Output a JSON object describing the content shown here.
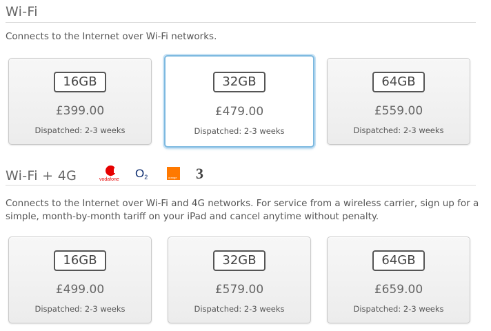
{
  "wifi": {
    "title": "Wi-Fi",
    "description": "Connects to the Internet over Wi-Fi networks.",
    "options": [
      {
        "capacity": "16GB",
        "price": "£399.00",
        "dispatch": "Dispatched: 2-3 weeks",
        "selected": false
      },
      {
        "capacity": "32GB",
        "price": "£479.00",
        "dispatch": "Dispatched: 2-3 weeks",
        "selected": true
      },
      {
        "capacity": "64GB",
        "price": "£559.00",
        "dispatch": "Dispatched: 2-3 weeks",
        "selected": false
      }
    ]
  },
  "wifi_4g": {
    "title": "Wi-Fi + 4G",
    "carriers": [
      {
        "name": "vodafone",
        "icon": "vodafone-logo",
        "label": "vodafone"
      },
      {
        "name": "O2",
        "icon": "o2-logo",
        "label": "O",
        "sub": "2"
      },
      {
        "name": "orange",
        "icon": "orange-logo",
        "label": "orange",
        "color": "#ff7900"
      },
      {
        "name": "3",
        "icon": "three-logo",
        "label": "3"
      }
    ],
    "description": "Connects to the Internet over Wi-Fi and 4G networks. For service from a wireless carrier, sign up for a simple, month-by-month tariff on your iPad and cancel anytime without penalty.",
    "options": [
      {
        "capacity": "16GB",
        "price": "£499.00",
        "dispatch": "Dispatched: 2-3 weeks",
        "selected": false
      },
      {
        "capacity": "32GB",
        "price": "£579.00",
        "dispatch": "Dispatched: 2-3 weeks",
        "selected": false
      },
      {
        "capacity": "64GB",
        "price": "£659.00",
        "dispatch": "Dispatched: 2-3 weeks",
        "selected": false
      }
    ]
  },
  "colors": {
    "selected_border": "#7db9e0",
    "vodafone_red": "#e60000",
    "o2_blue": "#0a2a6e",
    "orange": "#ff7900"
  }
}
